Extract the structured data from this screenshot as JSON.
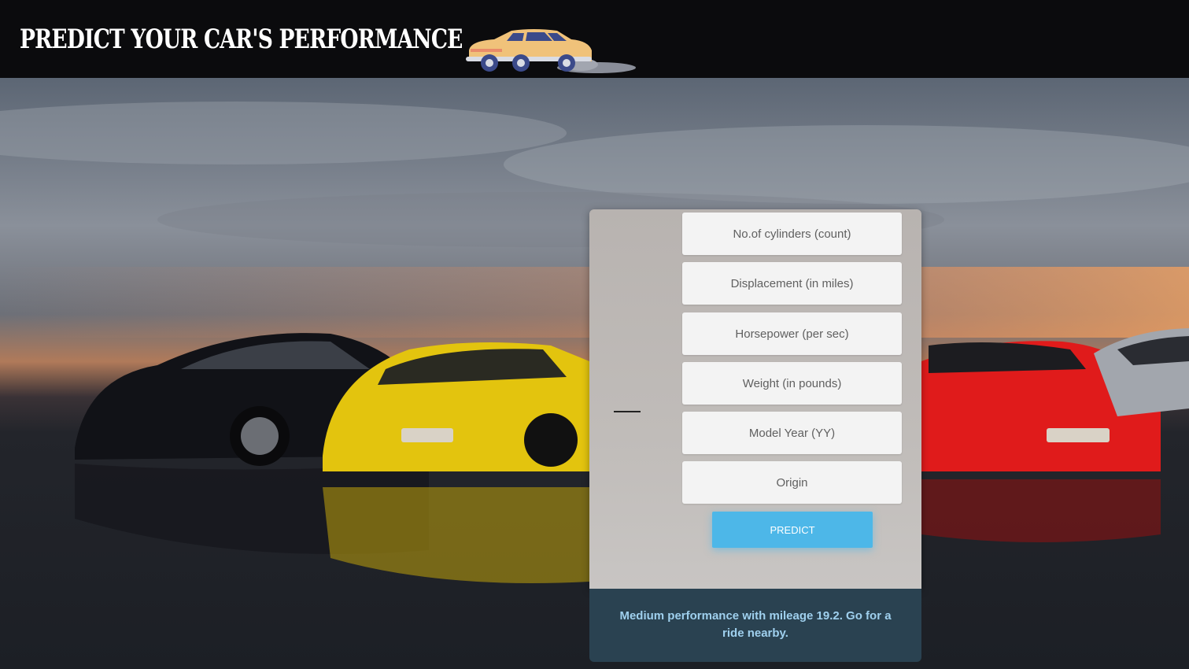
{
  "header": {
    "title": "PREDICT YOUR CAR'S PERFORMANCE",
    "logo_icon": "cartoon-car-icon"
  },
  "form": {
    "fields": [
      {
        "name": "cylinders",
        "placeholder": "No.of cylinders (count)",
        "value": ""
      },
      {
        "name": "displacement",
        "placeholder": "Displacement (in miles)",
        "value": ""
      },
      {
        "name": "horsepower",
        "placeholder": "Horsepower (per sec)",
        "value": ""
      },
      {
        "name": "weight",
        "placeholder": "Weight (in pounds)",
        "value": ""
      },
      {
        "name": "model_year",
        "placeholder": "Model Year (YY)",
        "value": ""
      },
      {
        "name": "origin",
        "placeholder": "Origin",
        "value": ""
      }
    ],
    "predict_label": "PREDICT"
  },
  "result": {
    "text": "Medium performance with mileage 19.2. Go for a ride nearby."
  },
  "colors": {
    "header_bg": "#0b0b0d",
    "panel_bg": "#bcb8b5",
    "button": "#4db7e8",
    "result_bg": "#2a4251",
    "result_text": "#9fd0ee"
  },
  "background": {
    "description_icon": "sports-cars-background"
  }
}
